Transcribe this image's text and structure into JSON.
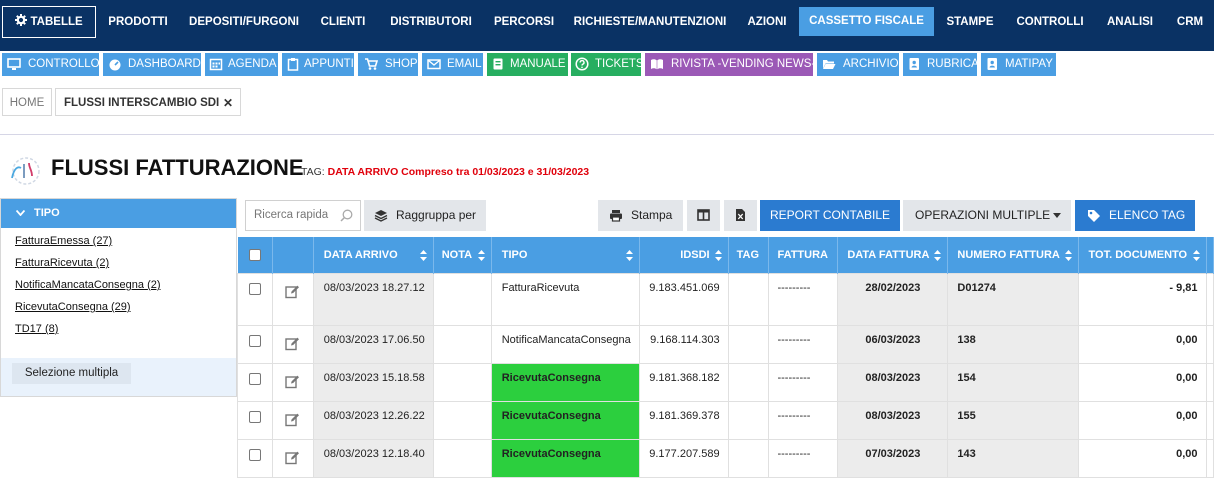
{
  "topnav": {
    "tabelle": "TABELLE",
    "items": [
      "PRODOTTI",
      "DEPOSITI/FURGONI",
      "CLIENTI",
      "DISTRIBUTORI",
      "PERCORSI",
      "RICHIESTE/MANUTENZIONI",
      "AZIONI",
      "CASSETTO FISCALE",
      "STAMPE",
      "CONTROLLI",
      "ANALISI",
      "CRM"
    ],
    "active": "CASSETTO FISCALE"
  },
  "quickbar": {
    "items": [
      "CONTROLLO",
      "DASHBOARD",
      "AGENDA",
      "APPUNTI",
      "SHOP",
      "EMAIL",
      "MANUALE",
      "TICKETS",
      "RIVISTA -VENDING NEWS-",
      "ARCHIVIO",
      "RUBRICA",
      "MATIPAY"
    ]
  },
  "tabs": {
    "home": "HOME",
    "current": "FLUSSI INTERSCAMBIO SDI",
    "close": "✕"
  },
  "page": {
    "title": "FLUSSI FATTURAZIONE",
    "tag_label": "TAG:",
    "tag_value": "DATA ARRIVO Compreso tra 01/03/2023 e 31/03/2023"
  },
  "sidebar": {
    "header": "TIPO",
    "items": [
      {
        "label": "FatturaEmessa",
        "count": "(27)"
      },
      {
        "label": "FatturaRicevuta",
        "count": "(2)"
      },
      {
        "label": "NotificaMancataConsegna",
        "count": "(2)"
      },
      {
        "label": "RicevutaConsegna",
        "count": "(29)"
      },
      {
        "label": "TD17",
        "count": "(8)"
      }
    ],
    "multi": "Selezione multipla"
  },
  "toolbar": {
    "search_placeholder": "Ricerca rapida",
    "group": "Raggruppa per",
    "print": "Stampa",
    "report": "REPORT CONTABILE",
    "operations": "OPERAZIONI MULTIPLE",
    "tags": "ELENCO TAG"
  },
  "table": {
    "headers": [
      "DATA ARRIVO",
      "NOTA",
      "TIPO",
      "IDSDI",
      "TAG",
      "FATTURA",
      "DATA FATTURA",
      "NUMERO FATTURA",
      "TOT. DOCUMENTO"
    ],
    "rows": [
      {
        "data_arrivo": "08/03/2023 18.27.12",
        "nota": "",
        "tipo": "FatturaRicevuta",
        "idsdi": "9.183.451.069",
        "tag": "",
        "fattura": "---------",
        "data_fattura": "28/02/2023",
        "numero": "D01274",
        "totale": "- 9,81"
      },
      {
        "data_arrivo": "08/03/2023 17.06.50",
        "nota": "",
        "tipo": "NotificaMancataConsegna",
        "idsdi": "9.168.114.303",
        "tag": "",
        "fattura": "---------",
        "data_fattura": "06/03/2023",
        "numero": "138",
        "totale": "0,00"
      },
      {
        "data_arrivo": "08/03/2023 15.18.58",
        "nota": "",
        "tipo": "RicevutaConsegna",
        "idsdi": "9.181.368.182",
        "tag": "",
        "fattura": "---------",
        "data_fattura": "08/03/2023",
        "numero": "154",
        "totale": "0,00"
      },
      {
        "data_arrivo": "08/03/2023 12.26.22",
        "nota": "",
        "tipo": "RicevutaConsegna",
        "idsdi": "9.181.369.378",
        "tag": "",
        "fattura": "---------",
        "data_fattura": "08/03/2023",
        "numero": "155",
        "totale": "0,00"
      },
      {
        "data_arrivo": "08/03/2023 12.18.40",
        "nota": "",
        "tipo": "RicevutaConsegna",
        "idsdi": "9.177.207.589",
        "tag": "",
        "fattura": "---------",
        "data_fattura": "07/03/2023",
        "numero": "143",
        "totale": "0,00"
      }
    ]
  },
  "colors": {
    "navy": "#0a3264",
    "accent": "#4a9ee3",
    "green": "#27ae60",
    "purple": "#9b59b6",
    "highlight": "#2ccf3e",
    "tag_red": "#e0000b"
  }
}
